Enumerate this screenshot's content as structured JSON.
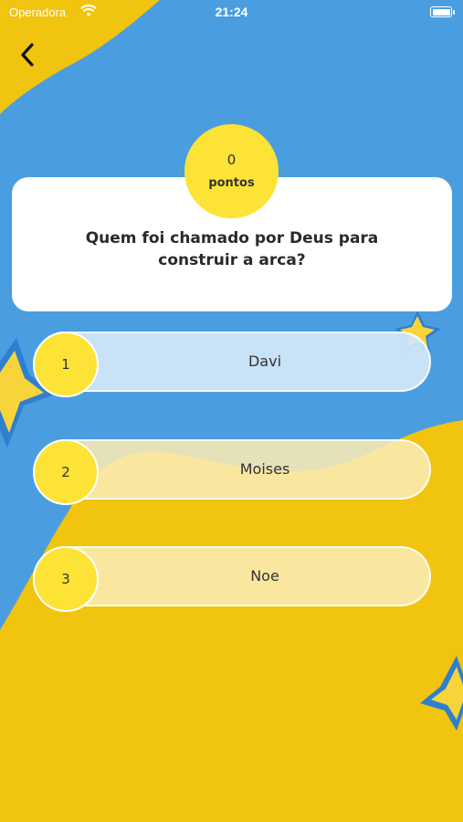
{
  "status_bar": {
    "carrier": "Operadora",
    "time": "21:24"
  },
  "navigation": {
    "back_icon": "chevron-left-icon"
  },
  "score": {
    "value": "0",
    "label": "pontos"
  },
  "question": {
    "text": "Quem foi chamado por Deus para construir a arca?"
  },
  "options": [
    {
      "number": "1",
      "label": "Davi"
    },
    {
      "number": "2",
      "label": "Moises"
    },
    {
      "number": "3",
      "label": "Noe"
    }
  ],
  "colors": {
    "background_blue": "#4a9ee0",
    "background_yellow": "#f1c40f",
    "accent_yellow": "#fde336"
  }
}
